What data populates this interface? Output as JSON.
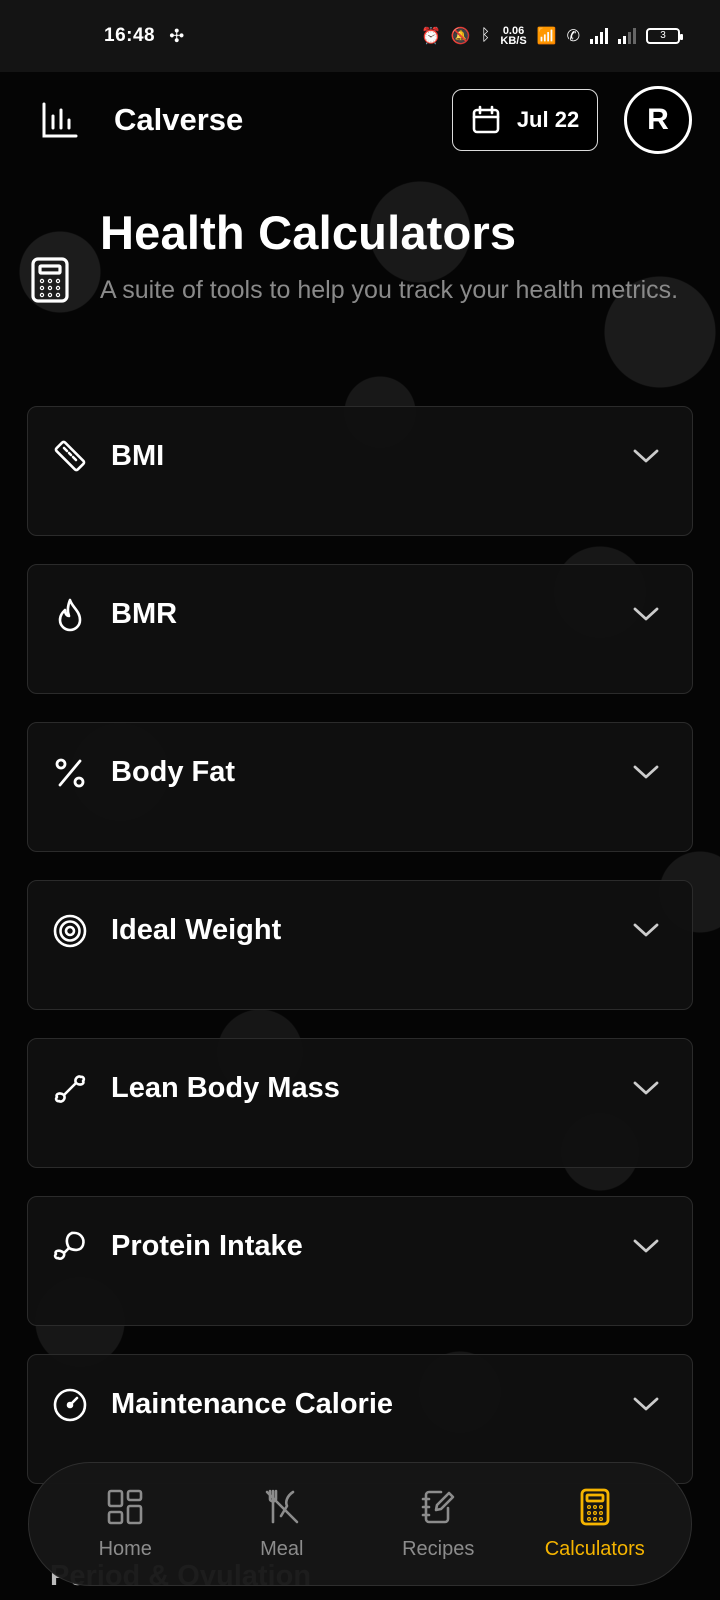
{
  "status_bar": {
    "time": "16:48",
    "net_speed_value": "0.06",
    "net_speed_unit": "KB/S",
    "battery": "3"
  },
  "header": {
    "app_title": "Calverse",
    "date_label": "Jul 22",
    "avatar_initial": "R"
  },
  "page": {
    "title": "Health Calculators",
    "subtitle": "A suite of tools to help you track your health metrics."
  },
  "calculators": [
    {
      "label": "BMI",
      "icon": "ruler-icon"
    },
    {
      "label": "BMR",
      "icon": "flame-icon"
    },
    {
      "label": "Body Fat",
      "icon": "percent-icon"
    },
    {
      "label": "Ideal Weight",
      "icon": "target-icon"
    },
    {
      "label": "Lean Body Mass",
      "icon": "bone-icon"
    },
    {
      "label": "Protein Intake",
      "icon": "drumstick-icon"
    },
    {
      "label": "Maintenance Calorie",
      "icon": "gauge-icon"
    }
  ],
  "partial_card_label": "Period & Ovulation",
  "bottom_nav": [
    {
      "label": "Home",
      "icon": "grid-icon",
      "active": false
    },
    {
      "label": "Meal",
      "icon": "utensils-icon",
      "active": false
    },
    {
      "label": "Recipes",
      "icon": "notebook-icon",
      "active": false
    },
    {
      "label": "Calculators",
      "icon": "calculator-icon",
      "active": true
    }
  ],
  "colors": {
    "accent": "#f5b400",
    "background": "#000000",
    "card": "#101010",
    "muted_text": "#8a8a8a"
  }
}
